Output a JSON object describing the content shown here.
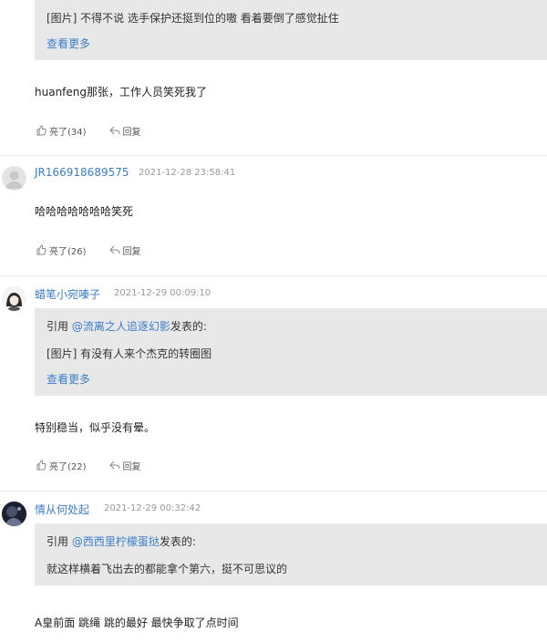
{
  "comments": [
    {
      "quote": {
        "lines": [
          "[图片] 不得不说 选手保护还挺到位的嗷 看着要倒了感觉扯住"
        ],
        "more": "查看更多"
      },
      "body": "huanfeng那张，工作人员笑死我了",
      "likes": "亮了(34)",
      "reply": "回复"
    },
    {
      "author": "JR166918689575",
      "time": "2021-12-28 23:58:41",
      "body": "哈哈哈哈哈哈哈笑死",
      "likes": "亮了(26)",
      "reply": "回复"
    },
    {
      "author": "蜡笔小宛嗪子",
      "time": "2021-12-29 00:09:10",
      "quote": {
        "prefix": "引用 ",
        "user": "@流离之人追逐幻影",
        "suffix": "发表的:",
        "lines": [
          "[图片] 有没有人来个杰克的转圈图"
        ],
        "more": "查看更多"
      },
      "body": "特别稳当，似乎没有晕。",
      "likes": "亮了(22)",
      "reply": "回复"
    },
    {
      "author": "情从何处起",
      "time": "2021-12-29 00:32:42",
      "quote": {
        "prefix": "引用 ",
        "user": "@西西里柠檬蛋挞",
        "suffix": "发表的:",
        "lines": [
          "就这样横着飞出去的都能拿个第六，挺不可思议的"
        ]
      },
      "body": "A皇前面 跳绳 跳的最好 最快争取了点时间"
    }
  ],
  "icons": {
    "like": "thumb-up-icon",
    "reply": "reply-arrow-icon",
    "default_avatar": "user-silhouette-icon"
  },
  "colors": {
    "link": "#3b7ec9",
    "quote_bg": "#e8e8e8",
    "meta": "#999999"
  }
}
